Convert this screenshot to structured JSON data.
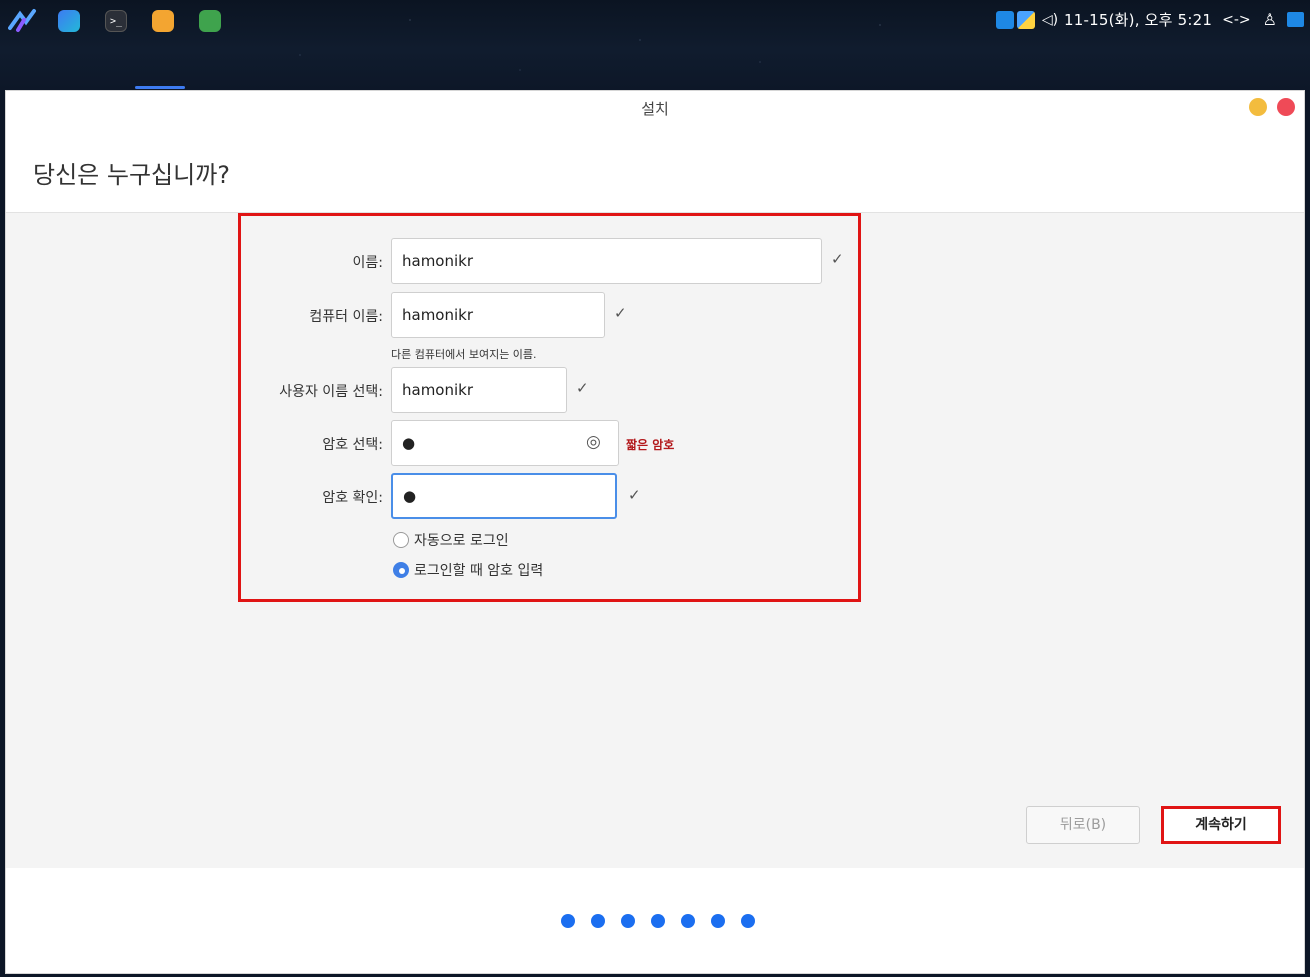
{
  "taskbar": {
    "apps": [
      "logo-icon",
      "editor-icon",
      "terminal-icon",
      "files-icon",
      "installer-icon"
    ],
    "terminal_glyph": ">_",
    "clock": "11-15(화), 오후 5:21",
    "volume_glyph": "◁)",
    "network_glyph": "<->",
    "user_glyph": "♙"
  },
  "window": {
    "title": "설치",
    "heading": "당신은 누구십니까?"
  },
  "form": {
    "name_label": "이름:",
    "name_value": "hamonikr",
    "computer_label": "컴퓨터 이름:",
    "computer_value": "hamonikr",
    "computer_hint": "다른 컴퓨터에서 보여지는 이름.",
    "username_label": "사용자 이름 선택:",
    "username_value": "hamonikr",
    "password_label": "암호 선택:",
    "password_value": "●",
    "password_strength": "짧은 암호",
    "confirm_label": "암호 확인:",
    "confirm_value": "●",
    "check_glyph": "✓",
    "eye_glyph": "◎",
    "radio_auto_login": "자동으로 로그인",
    "radio_require_password": "로그인할 때 암호 입력",
    "selected_option": "로그인할 때 암호 입력"
  },
  "buttons": {
    "back": "뒤로(B)",
    "continue": "계속하기"
  },
  "progress": {
    "steps_total": 7
  },
  "colors": {
    "accent": "#1b6ef0",
    "highlight": "#e01414",
    "warning": "#b3191c"
  }
}
